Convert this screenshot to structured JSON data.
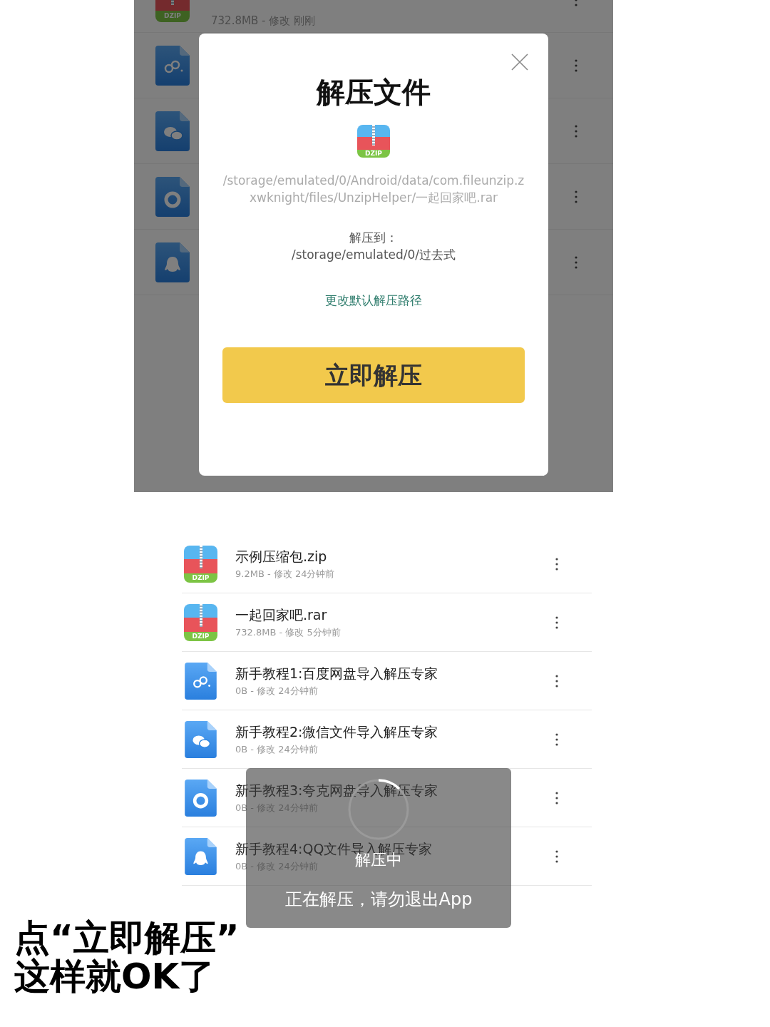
{
  "screens": [
    {
      "kind": "dialog",
      "files": [
        {
          "kind": "archive",
          "badge": "DZIP",
          "meta": "732.8MB - 修改 刚刚"
        },
        {
          "kind": "baidu"
        },
        {
          "kind": "wechat"
        },
        {
          "kind": "quark"
        },
        {
          "kind": "qq"
        }
      ],
      "dialog": {
        "title": "解压文件",
        "badge": "DZIP",
        "source_path": "/storage/emulated/0/Android/data/com.fileunzip.zxwknight/files/UnzipHelper/一起回家吧.rar",
        "target_label": "解压到：",
        "target_path": "/storage/emulated/0/过去式",
        "change_link": "更改默认解压路径",
        "confirm_button": "立即解压"
      }
    },
    {
      "kind": "progress",
      "files": [
        {
          "kind": "archive",
          "badge": "DZIP",
          "name": "示例压缩包.zip",
          "meta": "9.2MB - 修改 24分钟前"
        },
        {
          "kind": "archive",
          "badge": "DZIP",
          "name": "一起回家吧.rar",
          "meta": "732.8MB - 修改 5分钟前"
        },
        {
          "kind": "baidu",
          "name": "新手教程1:百度网盘导入解压专家",
          "meta": "0B - 修改 24分钟前"
        },
        {
          "kind": "wechat",
          "name": "新手教程2:微信文件导入解压专家",
          "meta": "0B - 修改 24分钟前"
        },
        {
          "kind": "quark",
          "name": "新手教程3:夸克网盘导入解压专家",
          "meta": "0B - 修改 24分钟前"
        },
        {
          "kind": "qq",
          "name": "新手教程4:QQ文件导入解压专家",
          "meta": "0B - 修改 24分钟前"
        }
      ],
      "toast": {
        "title": "解压中",
        "message": "正在解压，请勿退出App"
      }
    }
  ],
  "caption": [
    "点“立即解压”",
    "这样就OK了"
  ]
}
